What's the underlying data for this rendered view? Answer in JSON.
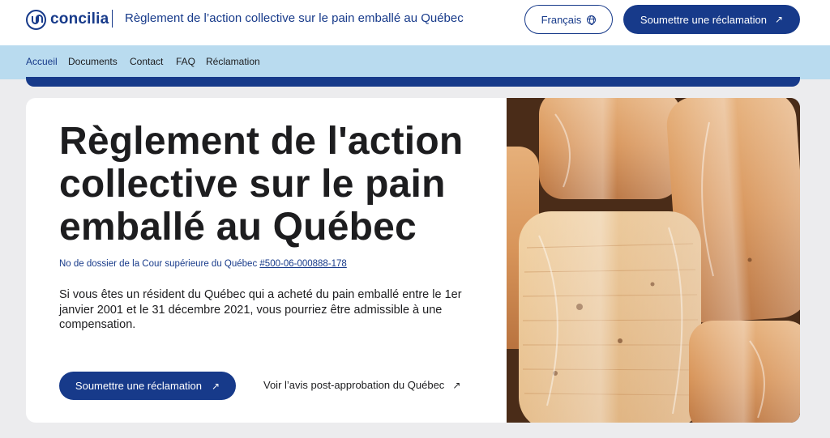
{
  "header": {
    "logo_text": "concilia",
    "site_title": "Règlement de l’action collective sur le pain emballé au Québec",
    "language_label": "Français",
    "cta_label": "Soumettre une réclamation"
  },
  "nav": {
    "items": [
      {
        "label": "Accueil",
        "active": true
      },
      {
        "label": "Documents"
      },
      {
        "label": "Contact"
      },
      {
        "label": "FAQ"
      },
      {
        "label": "Réclamation"
      }
    ]
  },
  "hero": {
    "title": "Règlement de l'action collective sur le pain emballé au Québec",
    "case_prefix": "No de dossier de la Cour supérieure du Québec",
    "case_number": "#500-06-000888-178",
    "description": "Si vous êtes un résident du Québec qui a acheté du pain emballé entre le 1er janvier 2001 et le 31 décembre 2021, vous pourriez être admissible à une compensation.",
    "cta_label": "Soumettre une réclamation",
    "notice_link": "Voir l’avis post-approbation du Québec"
  },
  "icons": {
    "globe": "globe-icon",
    "arrow": "arrow-up-right-icon"
  },
  "colors": {
    "brand": "#173a8a",
    "nav_background": "#b9dbef",
    "page_background": "#ececee"
  }
}
